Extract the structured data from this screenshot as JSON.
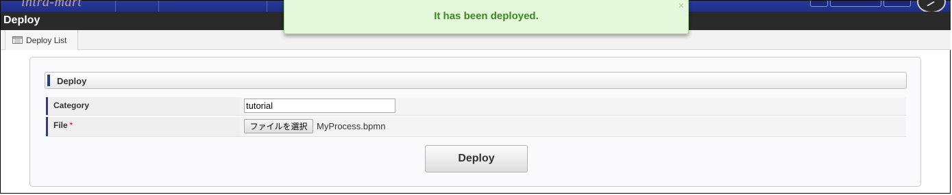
{
  "header": {
    "logo_text": "intra-mart",
    "page_title": "Deploy"
  },
  "tabs": [
    {
      "label": "Deploy List",
      "icon": "list-icon"
    }
  ],
  "section": {
    "title": "Deploy"
  },
  "form": {
    "category": {
      "label": "Category",
      "value": "tutorial"
    },
    "file": {
      "label": "File",
      "required_mark": "*",
      "button_label": "ファイルを選択",
      "file_name": "MyProcess.bpmn"
    },
    "submit_label": "Deploy"
  },
  "notification": {
    "message": "It has been deployed.",
    "close_symbol": "×"
  },
  "colors": {
    "accent": "#263c8c",
    "success_text": "#3c8a1e",
    "success_bg": "#e4f8dc"
  }
}
